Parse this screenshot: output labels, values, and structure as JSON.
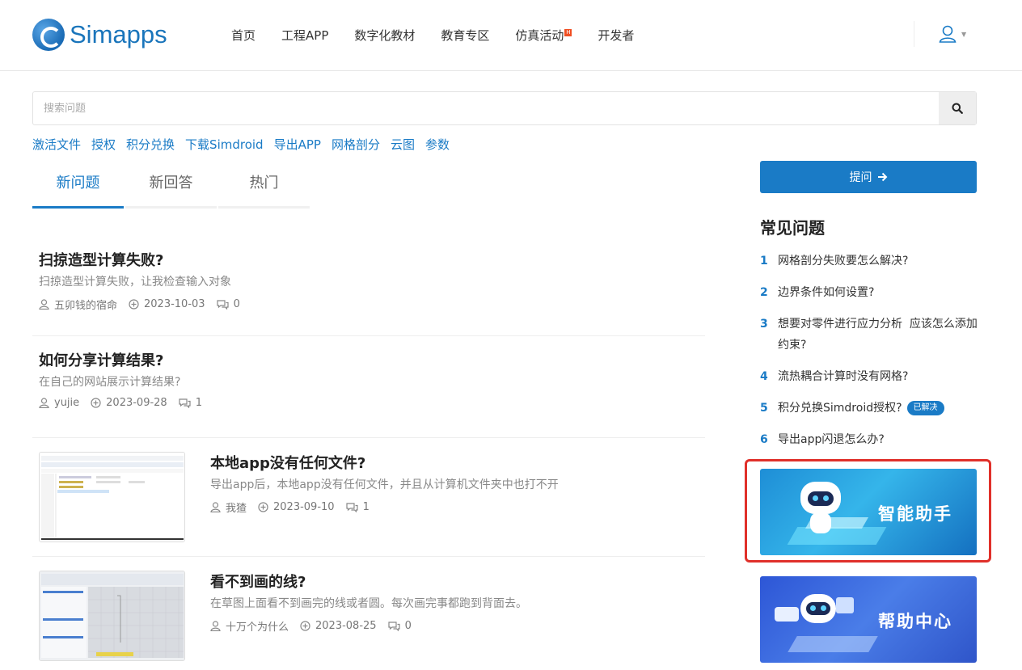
{
  "header": {
    "logo_text": "Simapps",
    "nav": [
      {
        "label": "首页"
      },
      {
        "label": "工程APP"
      },
      {
        "label": "数字化教材"
      },
      {
        "label": "教育专区"
      },
      {
        "label": "仿真活动",
        "badge": "H"
      },
      {
        "label": "开发者"
      }
    ]
  },
  "search": {
    "placeholder": "搜索问题",
    "value": ""
  },
  "quick_links": [
    "激活文件",
    "授权",
    "积分兑换",
    "下载Simdroid",
    "导出APP",
    "网格剖分",
    "云图",
    "参数"
  ],
  "tabs": [
    {
      "label": "新问题",
      "active": true
    },
    {
      "label": "新回答",
      "active": false
    },
    {
      "label": "热门",
      "active": false
    }
  ],
  "questions": [
    {
      "title": "扫掠造型计算失败?",
      "desc": "扫掠造型计算失败，让我检查输入对象",
      "author": "五卯钱的宿命",
      "date": "2023-10-03",
      "answers": "0"
    },
    {
      "title": "如何分享计算结果?",
      "desc": "在自己的网站展示计算结果?",
      "author": "yujie",
      "date": "2023-09-28",
      "answers": "1"
    },
    {
      "title": "本地app没有任何文件?",
      "desc": "导出app后，本地app没有任何文件，并且从计算机文件夹中也打不开",
      "author": "我猹",
      "date": "2023-09-10",
      "answers": "1"
    },
    {
      "title": "看不到画的线?",
      "desc": "在草图上面看不到画完的线或者圆。每次画完事都跑到背面去。",
      "author": "十万个为什么",
      "date": "2023-08-25",
      "answers": "0"
    }
  ],
  "sidebar": {
    "ask_label": "提问",
    "faq_title": "常见问题",
    "faq": [
      {
        "num": "1",
        "text": "网格剖分失败要怎么解决?"
      },
      {
        "num": "2",
        "text": "边界条件如何设置?"
      },
      {
        "num": "3",
        "text": "想要对零件进行应力分析  应该怎么添加约束?"
      },
      {
        "num": "4",
        "text": "流热耦合计算时没有网格?"
      },
      {
        "num": "5",
        "text": "积分兑换Simdroid授权?",
        "badge": "已解决"
      },
      {
        "num": "6",
        "text": "导出app闪退怎么办?"
      }
    ],
    "banners": [
      {
        "label": "智能助手"
      },
      {
        "label": "帮助中心"
      }
    ]
  },
  "colors": {
    "accent": "#1a7bc6",
    "highlight": "#e0302a",
    "hot_badge": "#f04f23"
  }
}
